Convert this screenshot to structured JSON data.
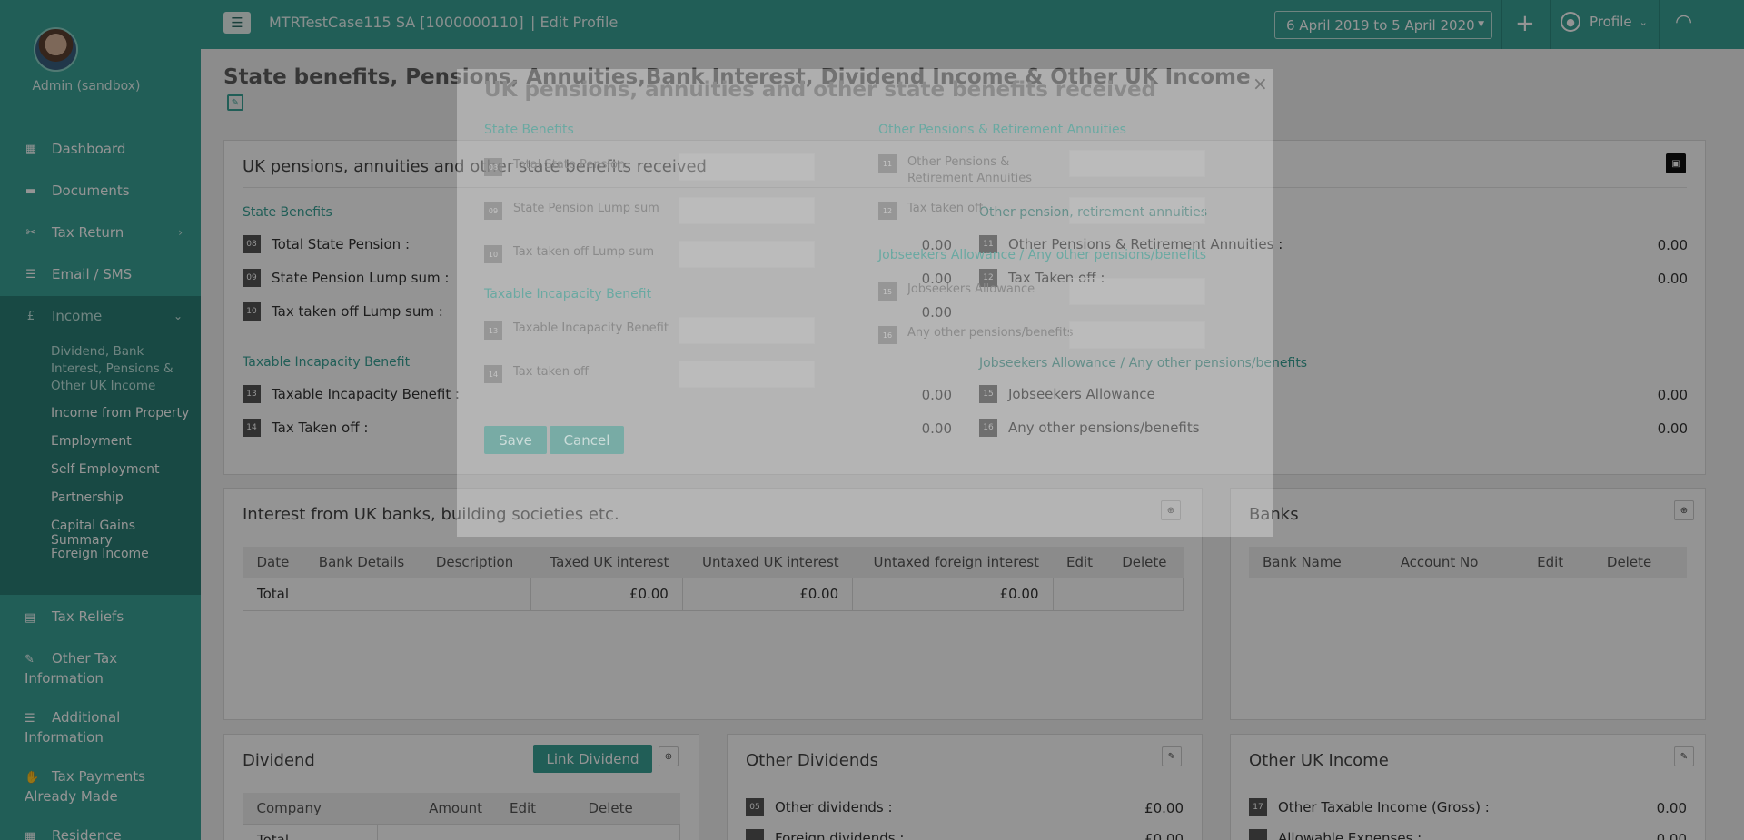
{
  "sidebar": {
    "user_name": "Admin (sandbox)",
    "items": [
      {
        "label": "Dashboard",
        "icon": "dashboard-icon"
      },
      {
        "label": "Documents",
        "icon": "folder-icon"
      },
      {
        "label": "Tax Return",
        "icon": "tax-return-icon"
      },
      {
        "label": "Email / SMS",
        "icon": "email-icon"
      },
      {
        "label": "Income",
        "icon": "pound-icon"
      }
    ],
    "income_sub": [
      "Dividend, Bank Interest, Pensions & Other UK Income",
      "Income from Property",
      "Employment",
      "Self Employment",
      "Partnership",
      "Capital Gains Summary",
      "Foreign Income"
    ],
    "lower_items": [
      {
        "label": "Tax Reliefs"
      },
      {
        "label": "Other Tax Information"
      },
      {
        "label": "Additional Information"
      },
      {
        "label": "Tax Payments Already Made"
      },
      {
        "label": "Residence"
      }
    ]
  },
  "topbar": {
    "case_title": "MTRTestCase115 SA [1000000110]",
    "page_sub": "| Edit Profile",
    "tax_year": "6 April 2019 to 5 April 2020",
    "plus": "+",
    "profile_label": "Profile"
  },
  "page_title": "State benefits, Pensions, Annuities,Bank Interest, Dividend Income & Other UK Income",
  "pensions_panel": {
    "title": "UK pensions, annuities and other state benefits received",
    "state_benefits_label": "State Benefits",
    "other_pension_label": "Other pension, retirement annuities",
    "incapacity_label": "Taxable Incapacity Benefit",
    "jobseekers_label": "Jobseekers Allowance / Any other pensions/benefits",
    "left_rows": [
      {
        "no": "08",
        "label": "Total State Pension :",
        "value": "0.00"
      },
      {
        "no": "09",
        "label": "State Pension Lump sum :",
        "value": "0.00"
      },
      {
        "no": "10",
        "label": "Tax taken off Lump sum :",
        "value": "0.00"
      },
      {
        "no": "13",
        "label": "Taxable Incapacity Benefit :",
        "value": "0.00"
      },
      {
        "no": "14",
        "label": "Tax Taken off :",
        "value": "0.00"
      }
    ],
    "right_rows": [
      {
        "no": "11",
        "label": "Other Pensions & Retirement Annuities :",
        "value": "0.00"
      },
      {
        "no": "12",
        "label": "Tax Taken off :",
        "value": "0.00"
      },
      {
        "no": "15",
        "label": "Jobseekers Allowance",
        "value": "0.00"
      },
      {
        "no": "16",
        "label": "Any other pensions/benefits",
        "value": "0.00"
      }
    ]
  },
  "interest_panel": {
    "title": "Interest from UK banks, building societies etc.",
    "columns": [
      "Date",
      "Bank Details",
      "Description",
      "Taxed UK interest",
      "Untaxed UK interest",
      "Untaxed foreign interest",
      "Edit",
      "Delete"
    ],
    "total_label": "Total",
    "totals": [
      "£0.00",
      "£0.00",
      "£0.00"
    ]
  },
  "banks_panel": {
    "title": "Banks",
    "columns": [
      "Bank Name",
      "Account No",
      "Edit",
      "Delete"
    ]
  },
  "dividend_panel": {
    "title": "Dividend",
    "link_button": "Link Dividend",
    "columns": [
      "Company",
      "Amount",
      "Edit",
      "Delete"
    ],
    "total_label": "Total"
  },
  "other_dividends_panel": {
    "title": "Other Dividends",
    "rows": [
      {
        "no": "05",
        "label": "Other dividends :",
        "value": "£0.00"
      },
      {
        "no": "",
        "label": "Foreign dividends :",
        "value": "£0.00"
      }
    ]
  },
  "other_uk_income_panel": {
    "title": "Other UK Income",
    "rows": [
      {
        "no": "17",
        "label": "Other Taxable Income (Gross) :",
        "value": "0.00"
      },
      {
        "no": "",
        "label": "Allowable Expenses :",
        "value": "0.00"
      }
    ]
  },
  "modal": {
    "title": "UK pensions, annuities and other state benefits received",
    "close": "×",
    "state_benefits_label": "State Benefits",
    "other_pensions_label": "Other Pensions & Retirement Annuities",
    "incapacity_label": "Taxable Incapacity Benefit",
    "jobseekers_label": "Jobseekers Allowance / Any other pensions/benefits",
    "left_fields": [
      {
        "no": "08",
        "label": "Total State Pension"
      },
      {
        "no": "09",
        "label": "State Pension Lump sum"
      },
      {
        "no": "10",
        "label": "Tax taken off Lump sum"
      },
      {
        "no": "13",
        "label": "Taxable Incapacity Benefit"
      },
      {
        "no": "14",
        "label": "Tax taken off"
      }
    ],
    "right_fields": [
      {
        "no": "11",
        "label": "Other Pensions & Retirement Annuities"
      },
      {
        "no": "12",
        "label": "Tax taken off"
      },
      {
        "no": "15",
        "label": "Jobseekers Allowance"
      },
      {
        "no": "16",
        "label": "Any other pensions/benefits"
      }
    ],
    "save_label": "Save",
    "cancel_label": "Cancel"
  },
  "colors": {
    "accent": "#3aa397",
    "accent_dark": "#2a7f75"
  }
}
